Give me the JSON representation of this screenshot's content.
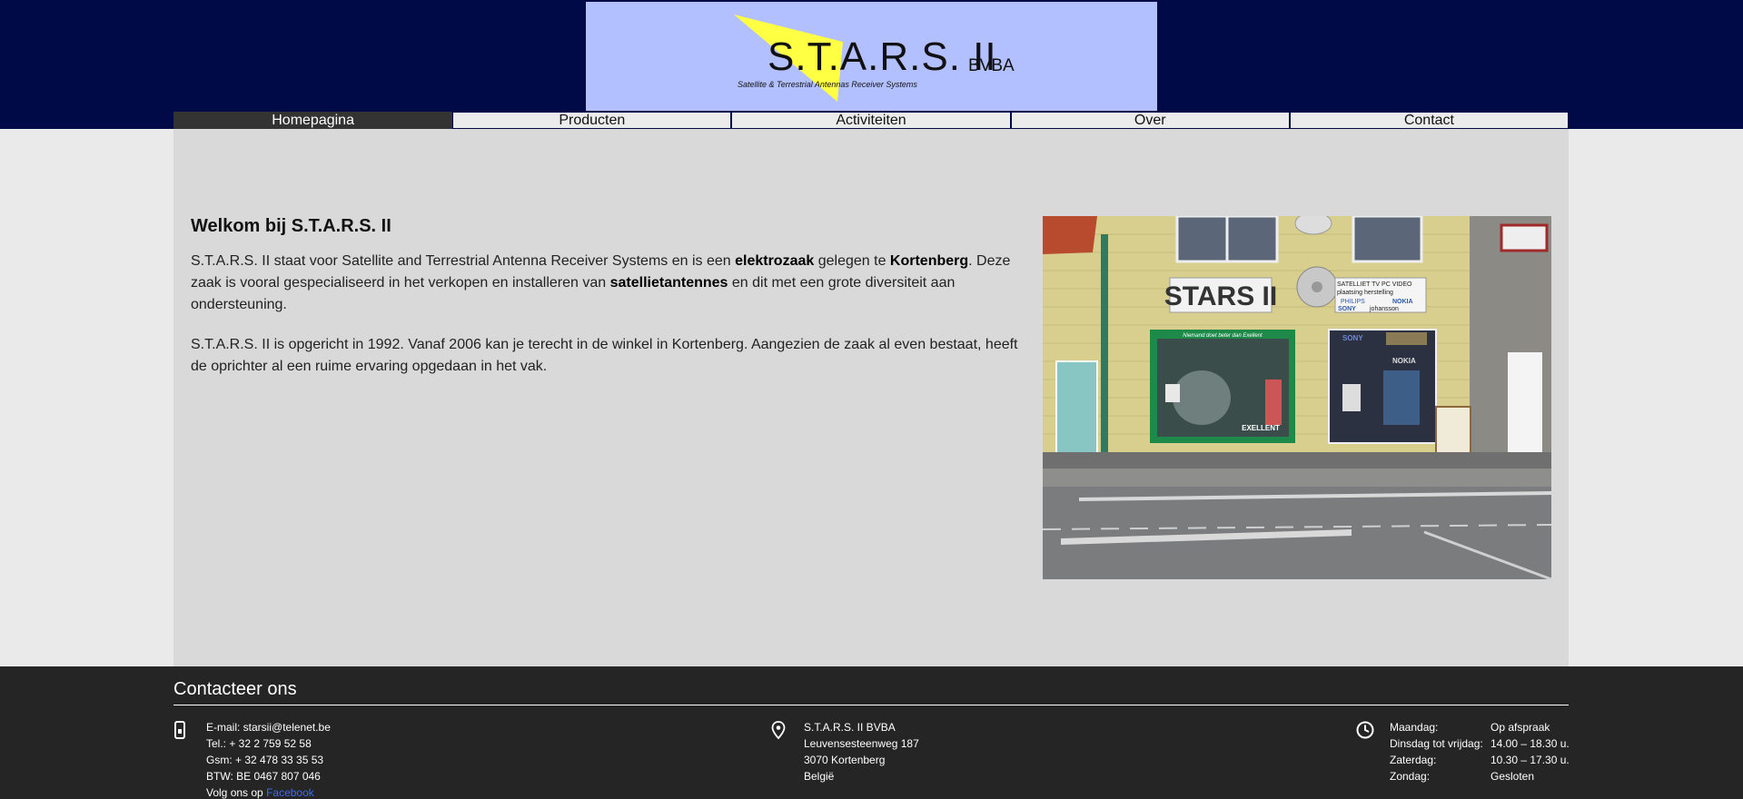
{
  "logo": {
    "title": "S.T.A.R.S. II",
    "suffix": "BVBA",
    "subtitle": "Satellite & Terrestrial Antennas Receiver Systems"
  },
  "nav": {
    "items": [
      {
        "label": "Homepagina"
      },
      {
        "label": "Producten"
      },
      {
        "label": "Activiteiten"
      },
      {
        "label": "Over"
      },
      {
        "label": "Contact"
      }
    ]
  },
  "main": {
    "heading": "Welkom bij S.T.A.R.S. II",
    "p1": {
      "t1": "S.T.A.R.S. II staat voor Satellite and Terrestrial Antenna Receiver Systems en is een ",
      "b1": "elektrozaak",
      "t2": " gelegen te ",
      "b2": "Kortenberg",
      "t3": ". Deze zaak is vooral gespecialiseerd in het verkopen en installeren van ",
      "b3": "satellietantennes",
      "t4": " en dit met een grote diversiteit aan ondersteuning."
    },
    "p2": "S.T.A.R.S. II is opgericht in 1992. Vanaf 2006 kan je terecht in de winkel in Kortenberg. Aangezien de zaak al even bestaat, heeft de oprichter al een ruime ervaring opgedaan in het vak.",
    "photo": {
      "sign": "STARS II",
      "window_slogan": "Niemand doet beter dan Exellent",
      "window_brand": "EXELLENT",
      "services_line1": "SATELLIET  TV  PC  VIDEO",
      "services_line2": "plaatsing   herstelling",
      "brand_philips": "PHILIPS",
      "brand_nokia": "NOKIA",
      "brand_sony": "SONY",
      "brand_johansson": "johansson"
    }
  },
  "footer": {
    "title": "Contacteer ons",
    "contact": {
      "email": "E-mail: starsii@telenet.be",
      "tel": "Tel.: + 32 2 759 52 58",
      "gsm": "Gsm: + 32 478 33 35 53",
      "btw": "BTW: BE 0467 807 046",
      "follow_prefix": "Volg ons op ",
      "facebook": "Facebook"
    },
    "address": {
      "name": "S.T.A.R.S. II BVBA",
      "street": "Leuvensesteenweg 187",
      "city": "3070 Kortenberg",
      "country": "België"
    },
    "hours": [
      {
        "day": "Maandag:",
        "time": "Op afspraak"
      },
      {
        "day": "Dinsdag tot vrijdag:",
        "time": "14.00 – 18.30 u."
      },
      {
        "day": "Zaterdag:",
        "time": "10.30 – 17.30 u."
      },
      {
        "day": "Zondag:",
        "time": "Gesloten"
      }
    ]
  },
  "colors": {
    "header_bg": "#000a47",
    "logo_bg": "#b3c0ff",
    "logo_triangle": "#ffff44",
    "nav_active_bg": "#333333",
    "main_bg": "#d9d9d9",
    "footer_bg": "#252525",
    "link": "#3c6cf0"
  },
  "icons": {
    "contact": "mobile-phone-icon",
    "address": "map-pin-icon",
    "hours": "clock-icon"
  }
}
